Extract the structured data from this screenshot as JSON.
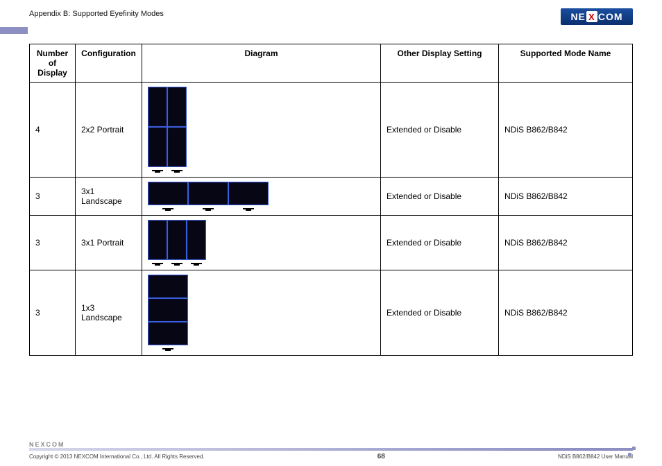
{
  "header": {
    "appendix": "Appendix B: Supported Eyefinity Modes",
    "logo_text_left": "NE",
    "logo_text_x": "X",
    "logo_text_right": "COM"
  },
  "table": {
    "headers": {
      "number": "Number of Display",
      "config": "Configuration",
      "diagram": "Diagram",
      "other": "Other Display Setting",
      "mode": "Supported Mode Name"
    },
    "rows": [
      {
        "number": "4",
        "config": "2x2 Portrait",
        "diagram_type": "2x2p",
        "other": "Extended or Disable",
        "mode": "NDiS B862/B842"
      },
      {
        "number": "3",
        "config": "3x1 Landscape",
        "diagram_type": "3x1l",
        "other": "Extended or Disable",
        "mode": "NDiS B862/B842"
      },
      {
        "number": "3",
        "config": "3x1 Portrait",
        "diagram_type": "3x1p",
        "other": "Extended or Disable",
        "mode": "NDiS B862/B842"
      },
      {
        "number": "3",
        "config": "1x3 Landscape",
        "diagram_type": "1x3l",
        "other": "Extended or Disable",
        "mode": "NDiS B862/B842"
      }
    ]
  },
  "footer": {
    "logo": "NEXCOM",
    "copyright": "Copyright © 2013 NEXCOM International Co., Ltd. All Rights Reserved.",
    "page": "68",
    "manual": "NDiS B862/B842 User Manual"
  }
}
